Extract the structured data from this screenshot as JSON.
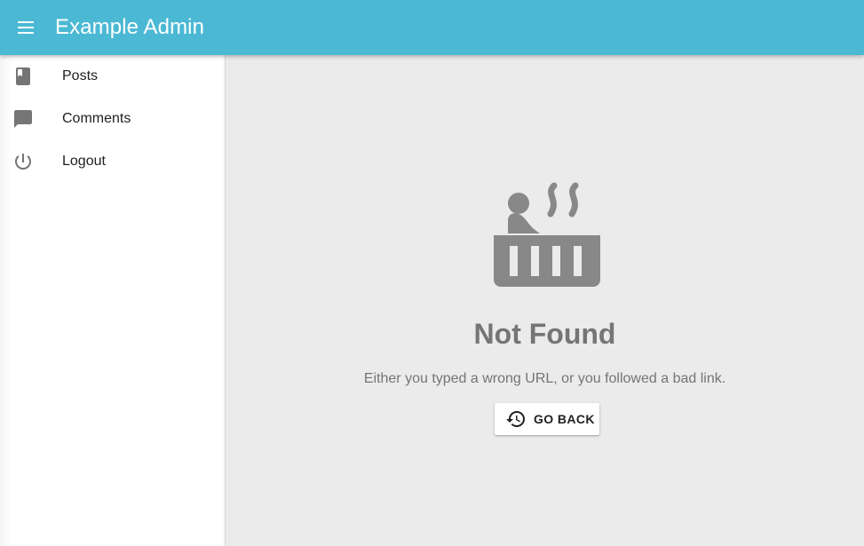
{
  "app": {
    "title": "Example Admin",
    "menu_icon": "menu-icon",
    "accent_color": "#4bb9d4"
  },
  "sidebar": {
    "items": [
      {
        "label": "Posts",
        "icon": "book-icon"
      },
      {
        "label": "Comments",
        "icon": "chat-bubble-icon"
      },
      {
        "label": "Logout",
        "icon": "power-icon"
      }
    ]
  },
  "not_found": {
    "icon": "hot-tub-icon",
    "title": "Not Found",
    "message": "Either you typed a wrong URL, or you followed a bad link.",
    "go_back_label": "GO BACK",
    "go_back_icon": "history-icon"
  }
}
